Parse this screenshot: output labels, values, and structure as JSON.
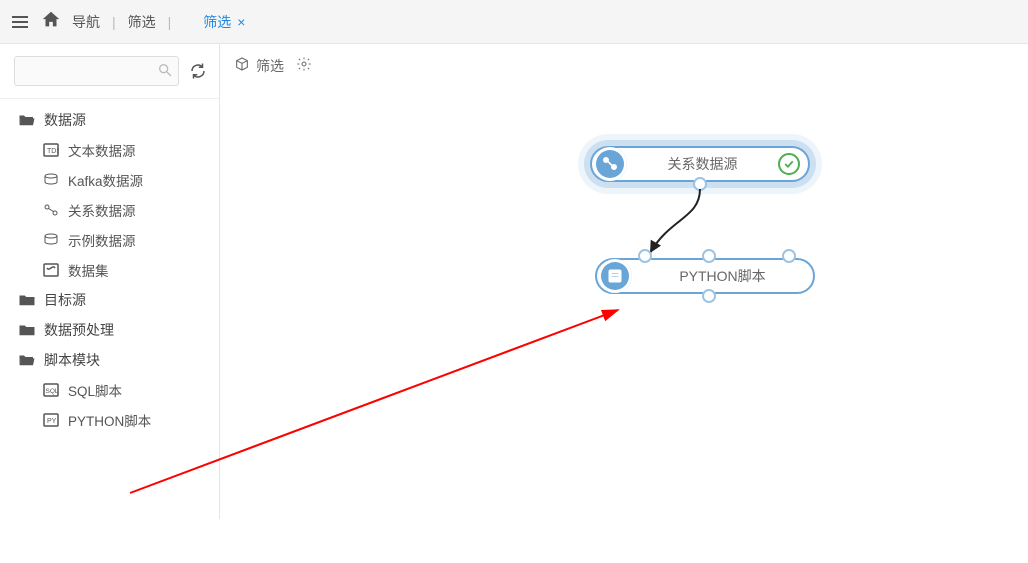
{
  "topbar": {
    "nav_label": "导航",
    "filter_label": "筛选",
    "active_tab": "筛选"
  },
  "sidebar": {
    "search_placeholder": "",
    "groups": {
      "datasource": {
        "label": "数据源",
        "items": [
          {
            "label": "文本数据源"
          },
          {
            "label": "Kafka数据源"
          },
          {
            "label": "关系数据源"
          },
          {
            "label": "示例数据源"
          },
          {
            "label": "数据集"
          }
        ]
      },
      "target": {
        "label": "目标源"
      },
      "preprocess": {
        "label": "数据预处理"
      },
      "script": {
        "label": "脚本模块",
        "items": [
          {
            "label": "SQL脚本"
          },
          {
            "label": "PYTHON脚本"
          }
        ]
      }
    }
  },
  "canvas": {
    "title": "筛选",
    "nodes": {
      "source": {
        "label": "关系数据源",
        "status": "ok"
      },
      "python": {
        "label": "PYTHON脚本"
      }
    }
  },
  "annotation": {
    "arrow_from": "sidebar-python-script",
    "arrow_to": "canvas-python-node"
  }
}
